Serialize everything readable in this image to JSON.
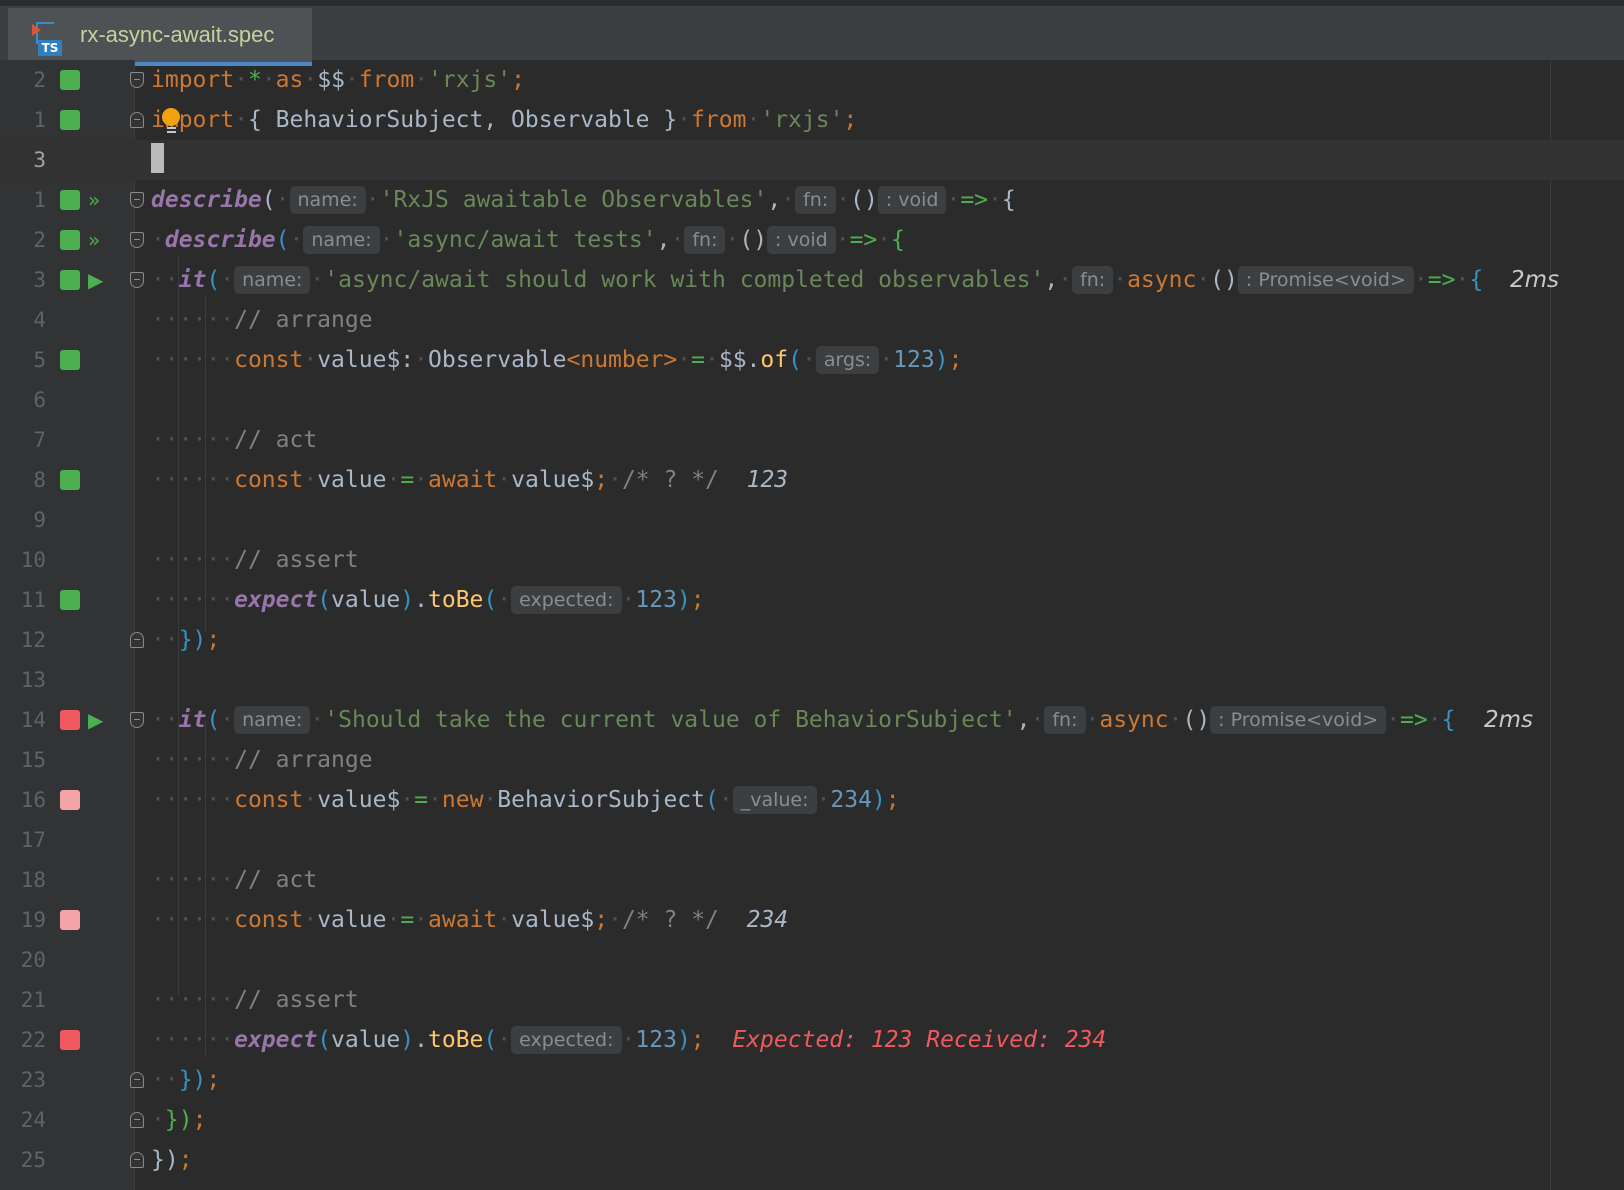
{
  "tab": {
    "file_name": "rx-async-await.spec",
    "icon": "typescript-file-icon",
    "icon_badge": "TS"
  },
  "lines": {
    "l1": {
      "num": "2",
      "coverage": "green"
    },
    "l2": {
      "num": "1",
      "coverage": "green"
    },
    "l3": {
      "num": "3"
    },
    "l4": {
      "num": "1",
      "coverage": "green"
    },
    "l5": {
      "num": "2",
      "coverage": "green"
    },
    "l6": {
      "num": "3",
      "coverage": "green",
      "time": "2ms"
    },
    "l7": {
      "num": "4"
    },
    "l8": {
      "num": "5",
      "coverage": "green"
    },
    "l9": {
      "num": "6"
    },
    "l10": {
      "num": "7"
    },
    "l11": {
      "num": "8",
      "coverage": "green",
      "result": "123"
    },
    "l12": {
      "num": "9"
    },
    "l13": {
      "num": "10"
    },
    "l14": {
      "num": "11",
      "coverage": "green"
    },
    "l15": {
      "num": "12"
    },
    "l16": {
      "num": "13"
    },
    "l17": {
      "num": "14",
      "coverage": "red",
      "time": "2ms"
    },
    "l18": {
      "num": "15"
    },
    "l19": {
      "num": "16",
      "coverage": "pink"
    },
    "l20": {
      "num": "17"
    },
    "l21": {
      "num": "18"
    },
    "l22": {
      "num": "19",
      "coverage": "pink",
      "result": "234"
    },
    "l23": {
      "num": "20"
    },
    "l24": {
      "num": "21"
    },
    "l25": {
      "num": "22",
      "coverage": "red",
      "error": "Expected: 123 Received: 234"
    },
    "l26": {
      "num": "23"
    },
    "l27": {
      "num": "24"
    },
    "l28": {
      "num": "25"
    }
  },
  "code": {
    "import_kw": "import",
    "star": "*",
    "as_kw": "as",
    "rx_alias": "$$",
    "from_kw": "from",
    "rxjs_str": "'rxjs'",
    "import2_names": "{ BehaviorSubject, Observable }",
    "describe_fn": "describe",
    "it_fn": "it",
    "hint_name": "name:",
    "hint_fn": "fn:",
    "hint_void": ": void",
    "hint_promise": ": Promise<void>",
    "hint_args": "args:",
    "hint_expected": "expected:",
    "hint_value": "_value:",
    "describe1_str": "'RxJS awaitable Observables'",
    "describe2_str": "'async/await tests'",
    "it1_str": "'async/await should work with completed observables'",
    "it2_str": "'Should take the current value of BehaviorSubject'",
    "async_kw": "async",
    "comment_arrange": "// arrange",
    "comment_act": "// act",
    "comment_assert": "// assert",
    "comment_quokka": "/* ? */",
    "const_kw": "const",
    "await_kw": "await",
    "new_kw": "new",
    "value_var": "value",
    "value_obs": "value$",
    "observable_type": "Observable",
    "number_type": "<number>",
    "of_method": "of",
    "expect_fn": "expect",
    "tobe_method": "toBe",
    "behavior_subject": "BehaviorSubject",
    "num_123": "123",
    "num_234": "234",
    "close_paren_semi": "});",
    "arrow": "=>"
  }
}
